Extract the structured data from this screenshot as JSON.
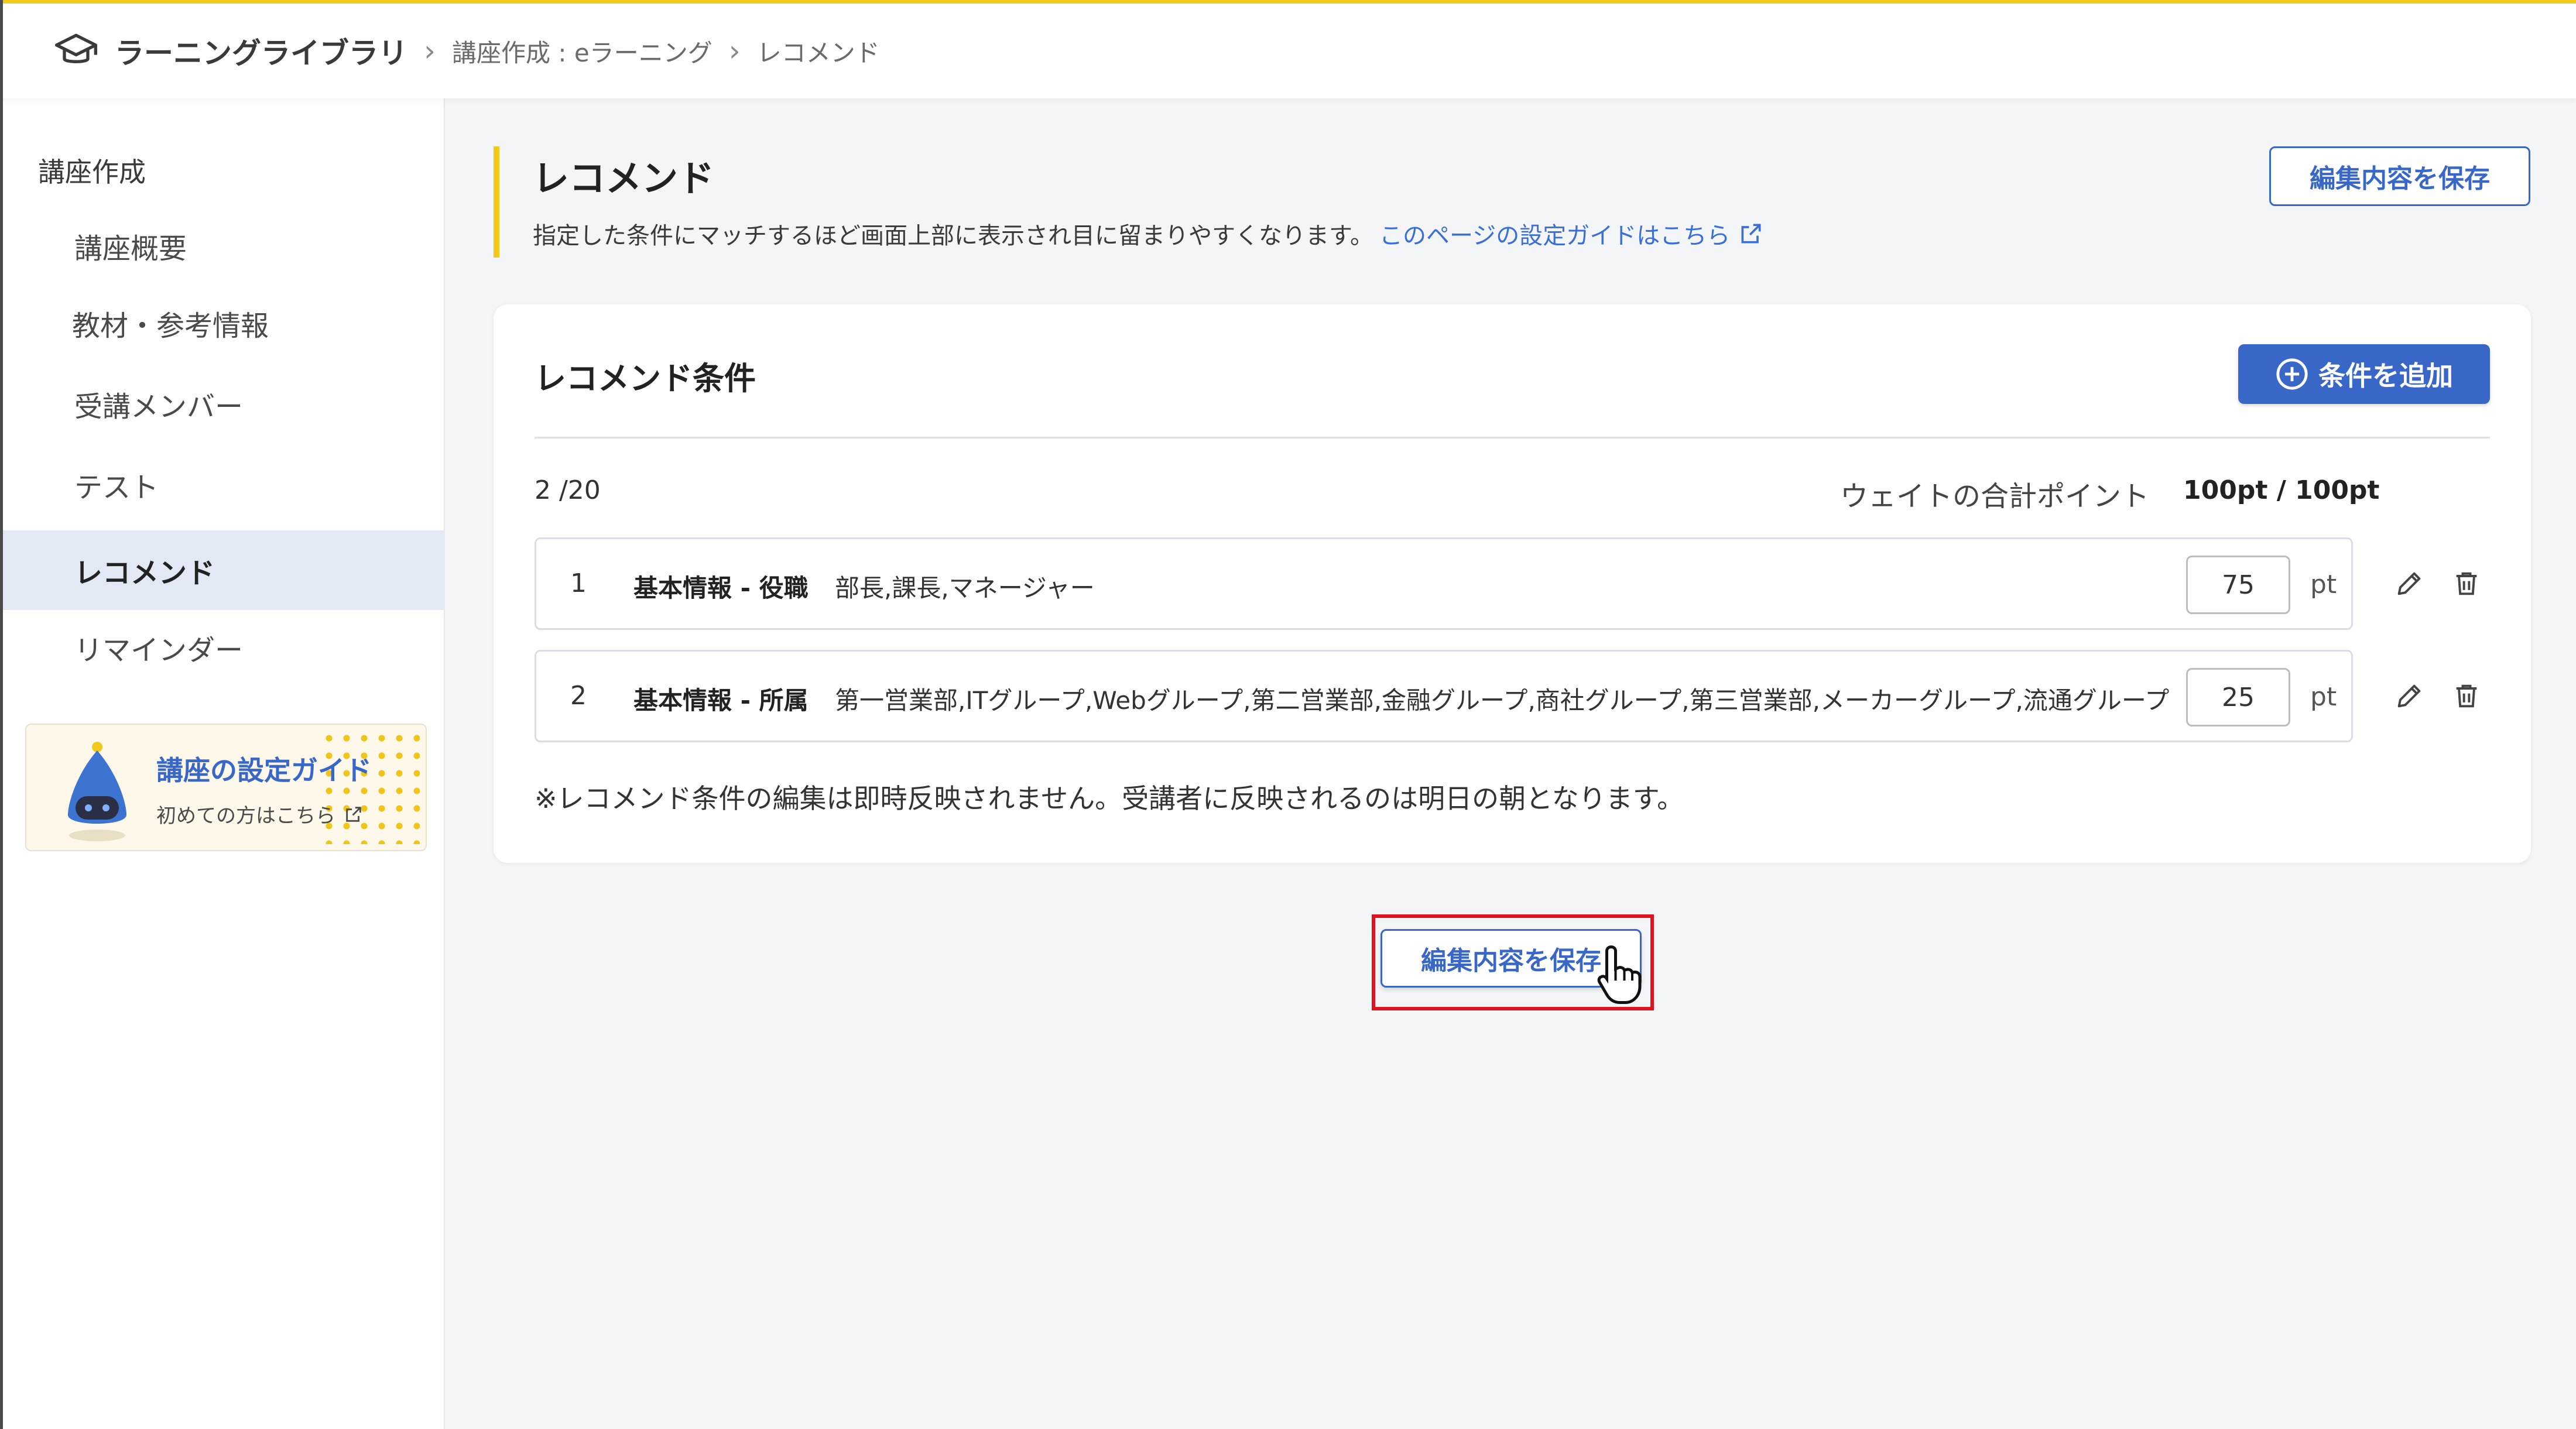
{
  "breadcrumb": {
    "app": "ラーニングライブラリ",
    "items": [
      "講座作成 : eラーニング",
      "レコメンド"
    ],
    "sep_icon": "chevron-right-icon"
  },
  "sidebar": {
    "heading": "講座作成",
    "items": [
      {
        "label": "講座概要",
        "active": false
      },
      {
        "label": "教材・参考情報",
        "active": false
      },
      {
        "label": "受講メンバー",
        "active": false
      },
      {
        "label": "テスト",
        "active": false
      },
      {
        "label": "レコメンド",
        "active": true
      },
      {
        "label": "リマインダー",
        "active": false
      }
    ],
    "guide": {
      "title": "講座の設定ガイド",
      "subtitle": "初めての方はこちら"
    }
  },
  "main": {
    "title": "レコメンド",
    "description": "指定した条件にマッチするほど画面上部に表示され目に留まりやすくなります。",
    "guide_link": "このページの設定ガイドはこちら",
    "save_label": "編集内容を保存"
  },
  "conditions": {
    "title": "レコメンド条件",
    "add_label": "条件を追加",
    "count": "2 /20",
    "weight_label": "ウェイトの合計ポイント",
    "weight_value": "100pt / 100pt",
    "pt_unit": "pt",
    "rows": [
      {
        "num": "1",
        "category": "基本情報 - 役職",
        "values": "部長,課長,マネージャー",
        "points": "75"
      },
      {
        "num": "2",
        "category": "基本情報 - 所属",
        "values": "第一営業部,ITグループ,Webグループ,第二営業部,金融グループ,商社グループ,第三営業部,メーカーグループ,流通グループ",
        "points": "25"
      }
    ],
    "note": "※レコメンド条件の編集は即時反映されません。受講者に反映されるのは明日の朝となります。"
  },
  "colors": {
    "accent": "#3867c7",
    "highlight": "#e0141e",
    "title_bar": "#f2c81b",
    "active_bg": "#e3e8f5"
  }
}
